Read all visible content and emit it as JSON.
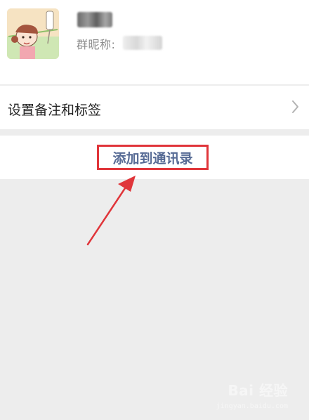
{
  "profile": {
    "nickname_label": "群昵称:"
  },
  "remark_row": {
    "label": "设置备注和标签"
  },
  "add_row": {
    "button_label": "添加到通讯录"
  },
  "watermark": {
    "main": "Bai 经验",
    "sub": "jingyan.baidu.com"
  },
  "colors": {
    "background": "#ededed",
    "link_blue": "#576b95",
    "annotation_red": "#e0353a"
  },
  "icons": [
    "avatar-image",
    "chevron-right-icon",
    "annotation-arrow",
    "baidu-paw-icon"
  ]
}
